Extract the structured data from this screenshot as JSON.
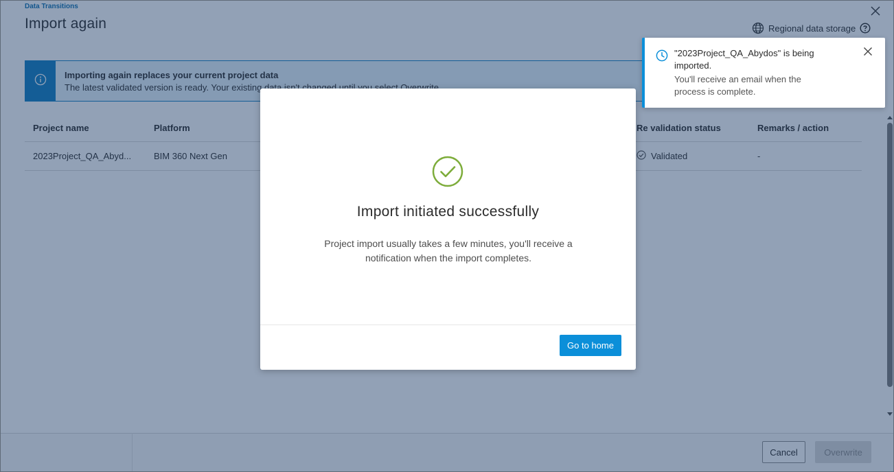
{
  "page": {
    "breadcrumb": "Data Transitions",
    "title": "Import again",
    "regional_label": "Regional data storage"
  },
  "banner": {
    "title": "Importing again replaces your current project data",
    "text": "The latest validated version is ready. Your existing data isn't changed until you select Overwrite."
  },
  "table": {
    "headers": [
      "Project name",
      "Platform",
      "Re validation status",
      "Remarks / action"
    ],
    "rows": [
      {
        "project": "2023Project_QA_Abyd...",
        "platform": "BIM 360 Next Gen",
        "status": "Validated",
        "remarks": "-"
      }
    ]
  },
  "footer": {
    "cancel": "Cancel",
    "overwrite": "Overwrite"
  },
  "modal": {
    "title": "Import initiated successfully",
    "body": "Project import usually takes a few minutes, you'll receive a notification when the import completes.",
    "button": "Go to home"
  },
  "toast": {
    "title": "\"2023Project_QA_Abydos\" is being imported.",
    "body": "You'll receive an email when the process is complete."
  },
  "colors": {
    "accent": "#0b8fd9",
    "success": "#7dac3a",
    "overlay": "#1c3a66"
  }
}
